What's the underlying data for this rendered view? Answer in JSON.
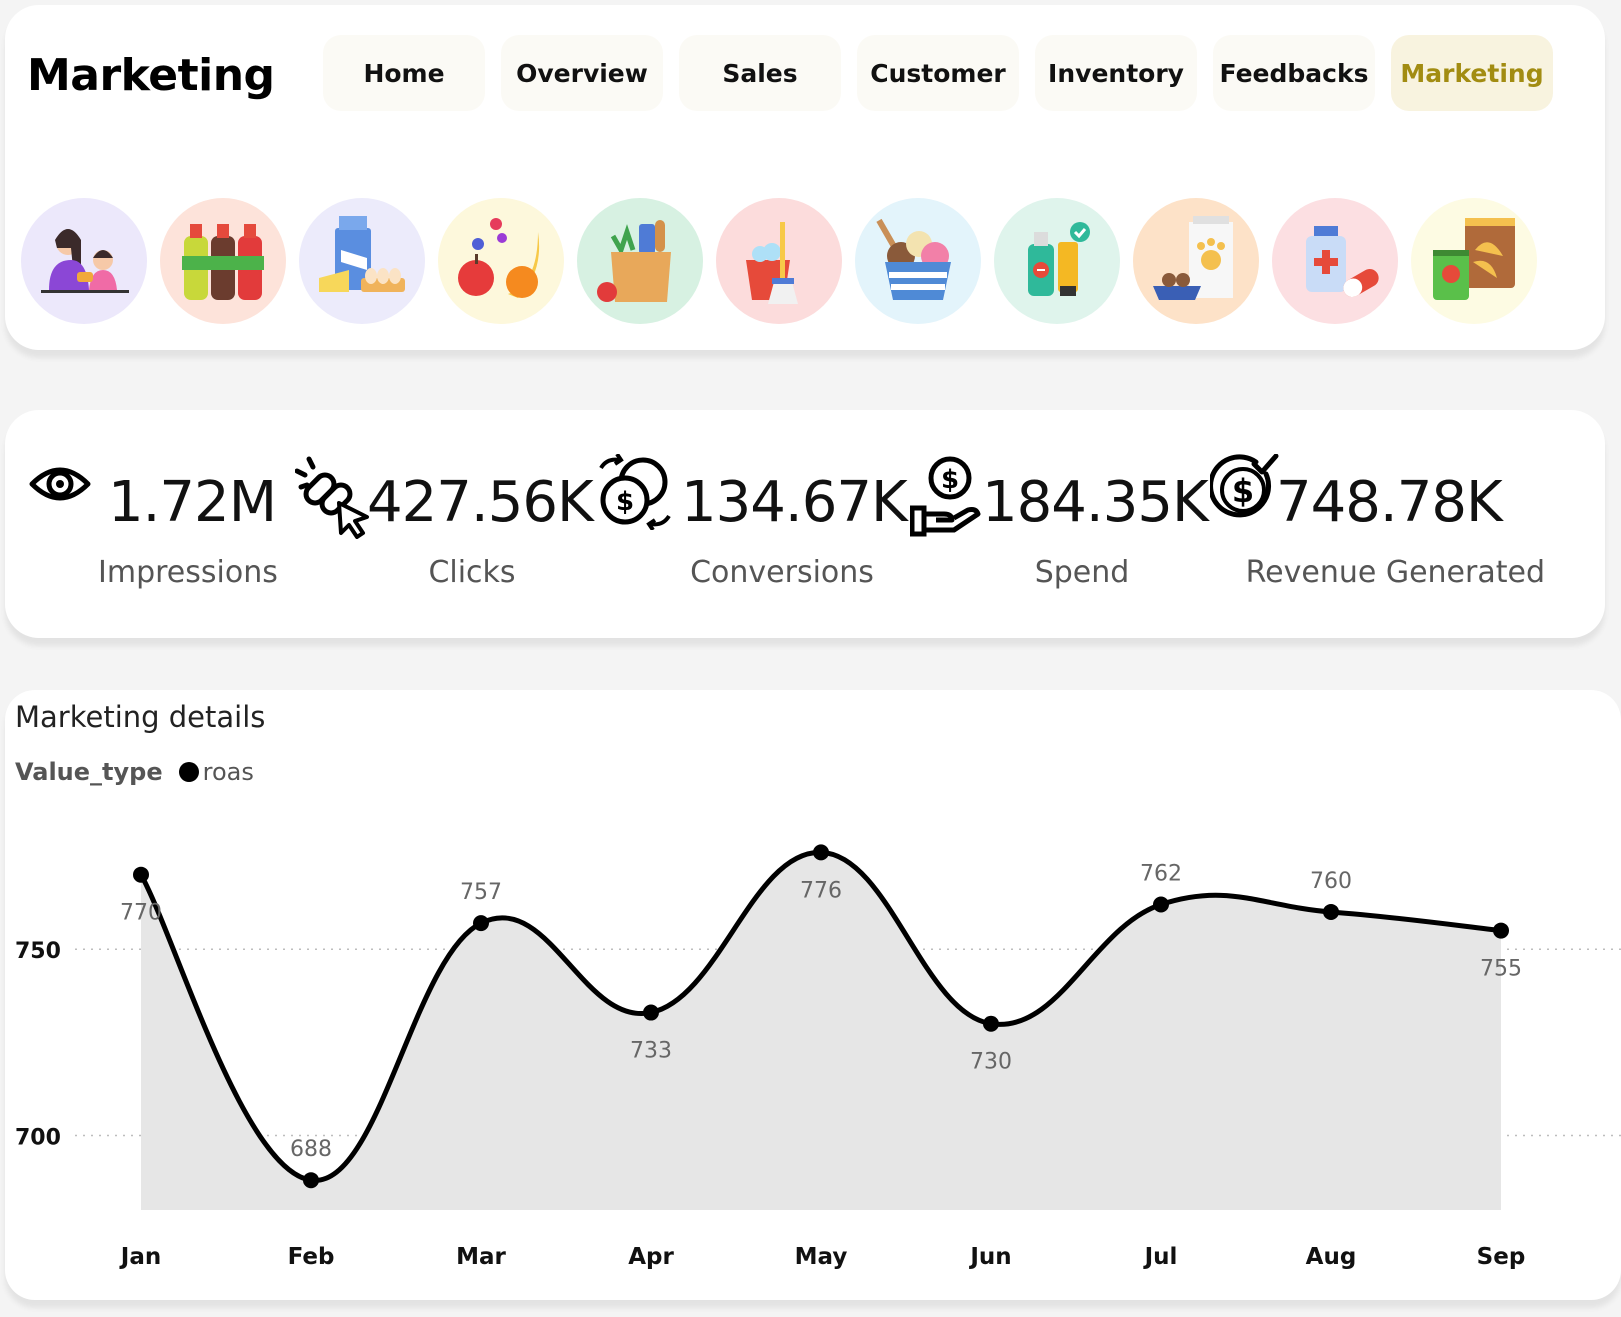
{
  "header": {
    "title": "Marketing",
    "nav": [
      {
        "label": "Home"
      },
      {
        "label": "Overview"
      },
      {
        "label": "Sales"
      },
      {
        "label": "Customer"
      },
      {
        "label": "Inventory"
      },
      {
        "label": "Feedbacks"
      },
      {
        "label": "Marketing",
        "active": true
      }
    ]
  },
  "categories": [
    {
      "icon": "baby-care-icon",
      "bg": "#ece8fb"
    },
    {
      "icon": "beverages-icon",
      "bg": "#fde3da"
    },
    {
      "icon": "dairy-eggs-icon",
      "bg": "#ecebfb"
    },
    {
      "icon": "fruits-icon",
      "bg": "#fdf8dc"
    },
    {
      "icon": "grocery-bag-icon",
      "bg": "#d7f1e2"
    },
    {
      "icon": "cleaning-icon",
      "bg": "#fcdcdc"
    },
    {
      "icon": "ice-cream-icon",
      "bg": "#e3f4fb"
    },
    {
      "icon": "personal-care-icon",
      "bg": "#dff4ec"
    },
    {
      "icon": "pet-food-icon",
      "bg": "#fde2c8"
    },
    {
      "icon": "pharmacy-icon",
      "bg": "#fcdfe2"
    },
    {
      "icon": "snacks-icon",
      "bg": "#fdfbe3"
    }
  ],
  "kpis": [
    {
      "icon": "eye-icon",
      "value": "1.72M",
      "label": "Impressions"
    },
    {
      "icon": "click-link-icon",
      "value": "427.56K",
      "label": "Clicks"
    },
    {
      "icon": "conversion-coins-icon",
      "value": "134.67K",
      "label": "Conversions"
    },
    {
      "icon": "hand-coin-icon",
      "value": "184.35K",
      "label": "Spend"
    },
    {
      "icon": "dollar-check-icon",
      "value": "748.78K",
      "label": "Revenue Generated"
    }
  ],
  "chart": {
    "title": "Marketing details",
    "legend_title": "Value_type",
    "legend_item": "roas"
  },
  "chart_data": {
    "type": "area",
    "title": "Marketing details",
    "categories": [
      "Jan",
      "Feb",
      "Mar",
      "Apr",
      "May",
      "Jun",
      "Jul",
      "Aug",
      "Sep"
    ],
    "series": [
      {
        "name": "roas",
        "values": [
          770,
          688,
          757,
          733,
          776,
          730,
          762,
          760,
          755
        ]
      }
    ],
    "yticks": [
      700,
      750
    ],
    "ylim": [
      680,
      782
    ],
    "grid": true,
    "legend": "top-left",
    "colors": {
      "line": "#000000",
      "area": "#e6e6e6",
      "label": "#666666"
    }
  }
}
